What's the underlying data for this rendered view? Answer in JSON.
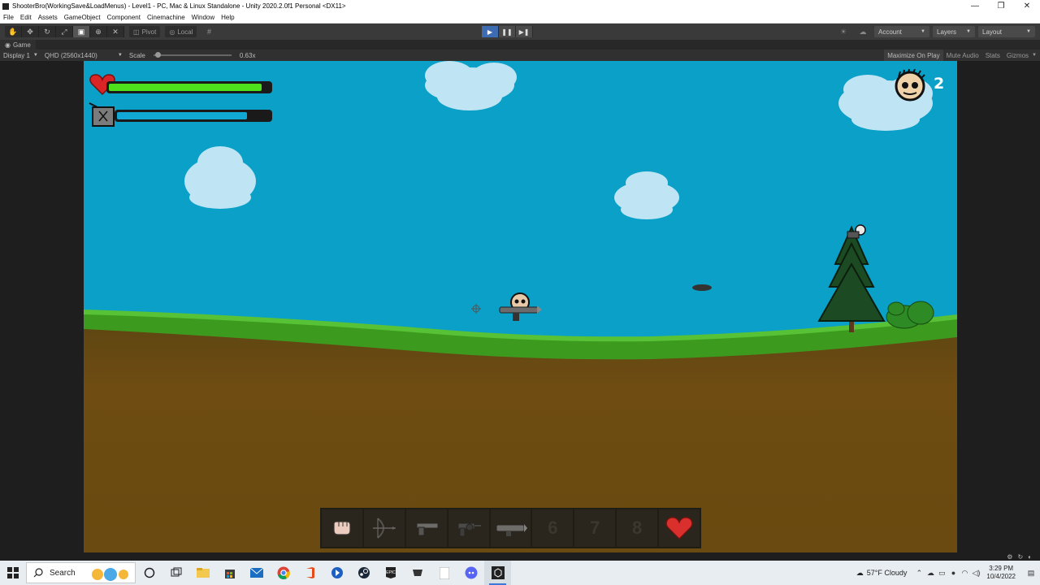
{
  "window": {
    "title": "ShooterBro(WorkingSave&LoadMenus) - Level1 - PC, Mac & Linux Standalone - Unity 2020.2.0f1 Personal <DX11>",
    "minimize": "—",
    "maximize": "❐",
    "close": "✕"
  },
  "menu": [
    "File",
    "Edit",
    "Assets",
    "GameObject",
    "Component",
    "Cinemachine",
    "Window",
    "Help"
  ],
  "toolbar": {
    "pivot_label": "Pivot",
    "local_label": "Local",
    "account_label": "Account",
    "layers_label": "Layers",
    "layout_label": "Layout"
  },
  "game_tab": {
    "tab_label": "Game",
    "display_label": "Display 1",
    "resolution_label": "QHD (2560x1440)",
    "scale_label": "Scale",
    "scale_value": "0.63x",
    "maximize_label": "Maximize On Play",
    "mute_label": "Mute Audio",
    "stats_label": "Stats",
    "gizmos_label": "Gizmos"
  },
  "hud": {
    "health_fraction": 0.95,
    "fuel_fraction": 0.85,
    "enemy_count": "2"
  },
  "hotbar": {
    "slot_6": "6",
    "slot_7": "7",
    "slot_8": "8"
  },
  "taskbar": {
    "search_label": "Search",
    "weather": "57°F  Cloudy",
    "time": "3:29 PM",
    "date": "10/4/2022"
  },
  "colors": {
    "sky": "#0aa0c8",
    "health": "#4fe01c",
    "fuel": "#12a8d4",
    "grass": "#3c9a1e",
    "dirt": "#6e4c12"
  }
}
